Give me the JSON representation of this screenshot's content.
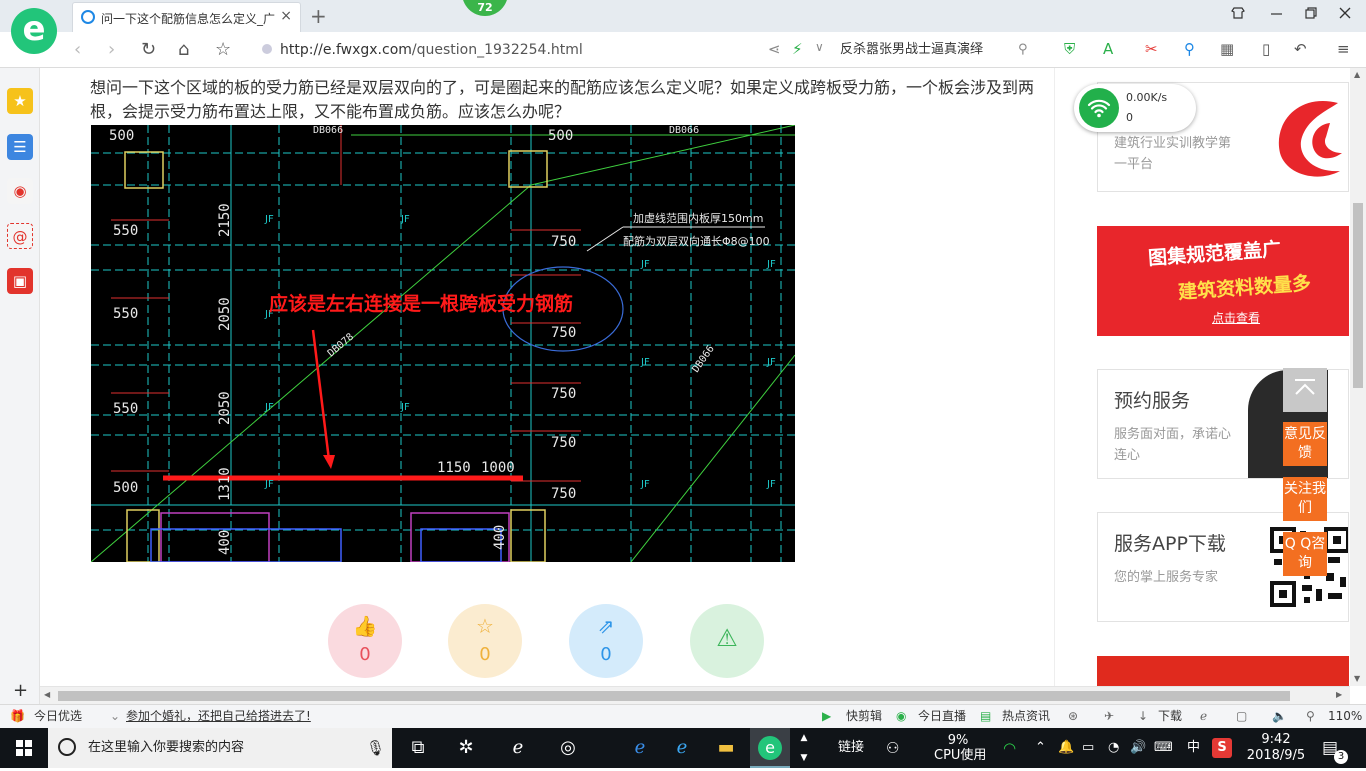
{
  "browser": {
    "tab_title": "问一下这个配筋信息怎么定义_广",
    "tab_close": "×",
    "new_tab": "+",
    "badge_count": "72",
    "url_domain": "http://e.fwxgx.com",
    "url_path": "/question_1932254.html",
    "search_text": "反杀嚣张男战士逼真演绎",
    "logo_letter": "e"
  },
  "question": {
    "text": "想问一下这个区域的板的受力筋已经是双层双向的了，可是圈起来的配筋应该怎么定义呢？如果定义成跨板受力筋，一个板会涉及到两根，会提示受力筋布置达上限，又不能布置成负筋。应该怎么办呢？"
  },
  "cad": {
    "annotation": "应该是左右连接是一根跨板受力钢筋",
    "note_line1": "加虚线范围内板厚150mm",
    "note_line2": "配筋为双层双向通长Φ8@100",
    "dims_left": [
      "500",
      "550",
      "550",
      "550",
      "500"
    ],
    "dims_vertical": [
      "2150",
      "2050",
      "2050",
      "1310",
      "400",
      "400"
    ],
    "dims_right": [
      "500",
      "750",
      "750",
      "750",
      "750",
      "750"
    ],
    "dims_bottom": [
      "1150",
      "1000"
    ],
    "labels_jf": "JF",
    "beam_labels": [
      "DB066",
      "DB066",
      "DB078",
      "DB066"
    ],
    "colors": {
      "annotation": "#ff1a1a",
      "grid": "#1ec8c8",
      "dim": "#e8e8e8",
      "column": "#e0d060"
    }
  },
  "reactions": [
    {
      "name": "like",
      "icon": "👍",
      "count": "0",
      "bg": "#fadadf",
      "fg": "#e8505b"
    },
    {
      "name": "favorite",
      "icon": "☆",
      "count": "0",
      "bg": "#fbecd0",
      "fg": "#efb13b"
    },
    {
      "name": "share",
      "icon": "⇗",
      "count": "0",
      "bg": "#d4ebfb",
      "fg": "#2e95e8"
    },
    {
      "name": "report",
      "icon": "⚠",
      "count": "",
      "bg": "#d9f2de",
      "fg": "#3cb55a"
    }
  ],
  "speed_widget": {
    "rate": "0.00K/s",
    "count": "0"
  },
  "sidebar_cards": [
    {
      "title": "",
      "desc": "建筑行业实训教学第一平台"
    },
    {
      "title": "图集规范覆盖广",
      "subtitle": "建筑资料数量多",
      "cta": "点击查看"
    },
    {
      "title": "预约服务",
      "desc": "服务面对面，承诺心连心"
    },
    {
      "title": "服务APP下载",
      "desc": "您的掌上服务专家"
    }
  ],
  "floating": {
    "feedback": "意见反馈",
    "follow": "关注我们",
    "qq": "Q Q咨询"
  },
  "statusbar": {
    "today_pick": "今日优选",
    "news": "参加个婚礼，还把自己给搭进去了!",
    "clip": "快剪辑",
    "live": "今日直播",
    "hot": "热点资讯",
    "download": "下载",
    "zoom": "110%"
  },
  "taskbar": {
    "search_placeholder": "在这里输入你要搜索的内容",
    "link_label": "链接",
    "cpu_value": "9%",
    "cpu_label": "CPU使用",
    "ime": "中",
    "time": "9:42",
    "date": "2018/9/5",
    "notifications": "3"
  }
}
